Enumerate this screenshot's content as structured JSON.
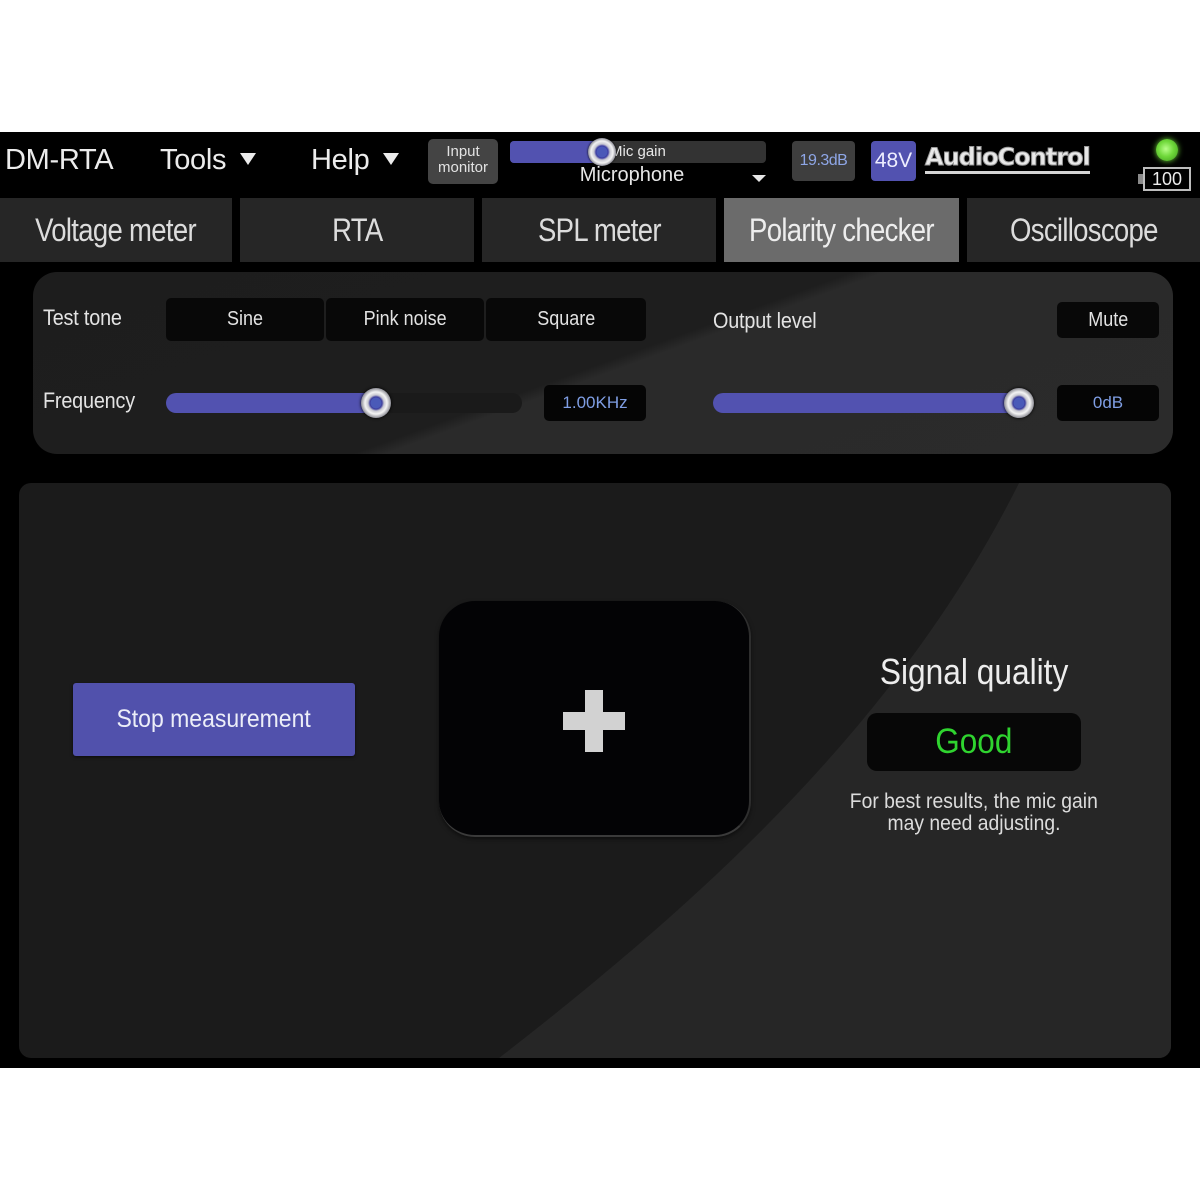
{
  "header": {
    "app_title": "DM-RTA",
    "menus": [
      {
        "label": "Tools"
      },
      {
        "label": "Help"
      }
    ],
    "input_monitor_label": [
      "Input",
      "monitor"
    ],
    "mic_gain": {
      "label": "Mic gain",
      "level_percent": 36
    },
    "input_source": "Microphone",
    "gain_readout": "19.3dB",
    "phantom_power_label": "48V",
    "brand": "AudioControl",
    "status_led_color": "#6fd83a",
    "battery_level": "100"
  },
  "tabs": [
    {
      "label": "Voltage meter",
      "active": false
    },
    {
      "label": "RTA",
      "active": false
    },
    {
      "label": "SPL meter",
      "active": false
    },
    {
      "label": "Polarity checker",
      "active": true
    },
    {
      "label": "Oscilloscope",
      "active": false
    }
  ],
  "tone_panel": {
    "test_tone_label": "Test tone",
    "tone_options": [
      "Sine",
      "Pink noise",
      "Square"
    ],
    "frequency_label": "Frequency",
    "frequency_slider_percent": 59,
    "frequency_value": "1.00KHz",
    "output_level_label": "Output level",
    "mute_label": "Mute",
    "output_slider_percent": 100,
    "output_value": "0dB"
  },
  "measurement": {
    "stop_button_label": "Stop measurement",
    "polarity_icon": "plus-icon",
    "polarity_result": "+",
    "signal_quality_title": "Signal quality",
    "signal_quality_value": "Good",
    "signal_quality_color": "#2fd42f",
    "hint_lines": [
      "For best results, the mic gain",
      "may need adjusting."
    ]
  },
  "colors": {
    "accent": "#5252b0",
    "readout_text": "#7f9ee4",
    "active_tab": "#6b6b6b"
  }
}
